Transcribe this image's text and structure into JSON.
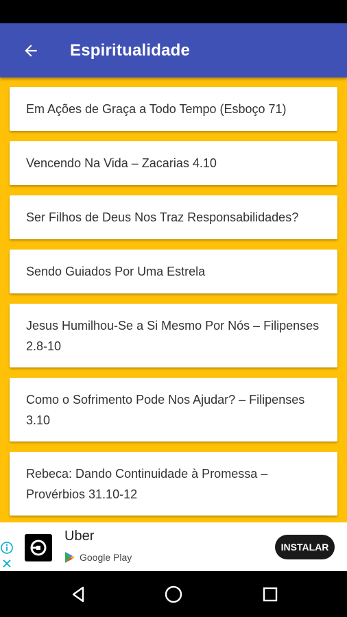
{
  "app_bar": {
    "title": "Espiritualidade",
    "back_icon": "arrow-back-icon",
    "background": "#3f51b5"
  },
  "list": {
    "background": "#ffc107",
    "items": [
      {
        "title": "Em Ações de Graça a Todo Tempo (Esboço 71)"
      },
      {
        "title": "Vencendo Na Vida – Zacarias 4.10"
      },
      {
        "title": "Ser Filhos de Deus Nos Traz Responsabilidades?"
      },
      {
        "title": "Sendo Guiados Por Uma Estrela"
      },
      {
        "title": "Jesus Humilhou-Se a Si Mesmo Por Nós – Filipenses 2.8-10"
      },
      {
        "title": "Como o Sofrimento Pode Nos Ajudar? – Filipenses 3.10"
      },
      {
        "title": "Rebeca: Dando Continuidade à Promessa – Provérbios 31.10-12"
      }
    ]
  },
  "ad": {
    "app_name": "Uber",
    "store": "Google Play",
    "install_label": "INSTALAR"
  },
  "nav_bar": {
    "back_icon": "nav-back-icon",
    "home_icon": "nav-home-icon",
    "recents_icon": "nav-recents-icon"
  }
}
